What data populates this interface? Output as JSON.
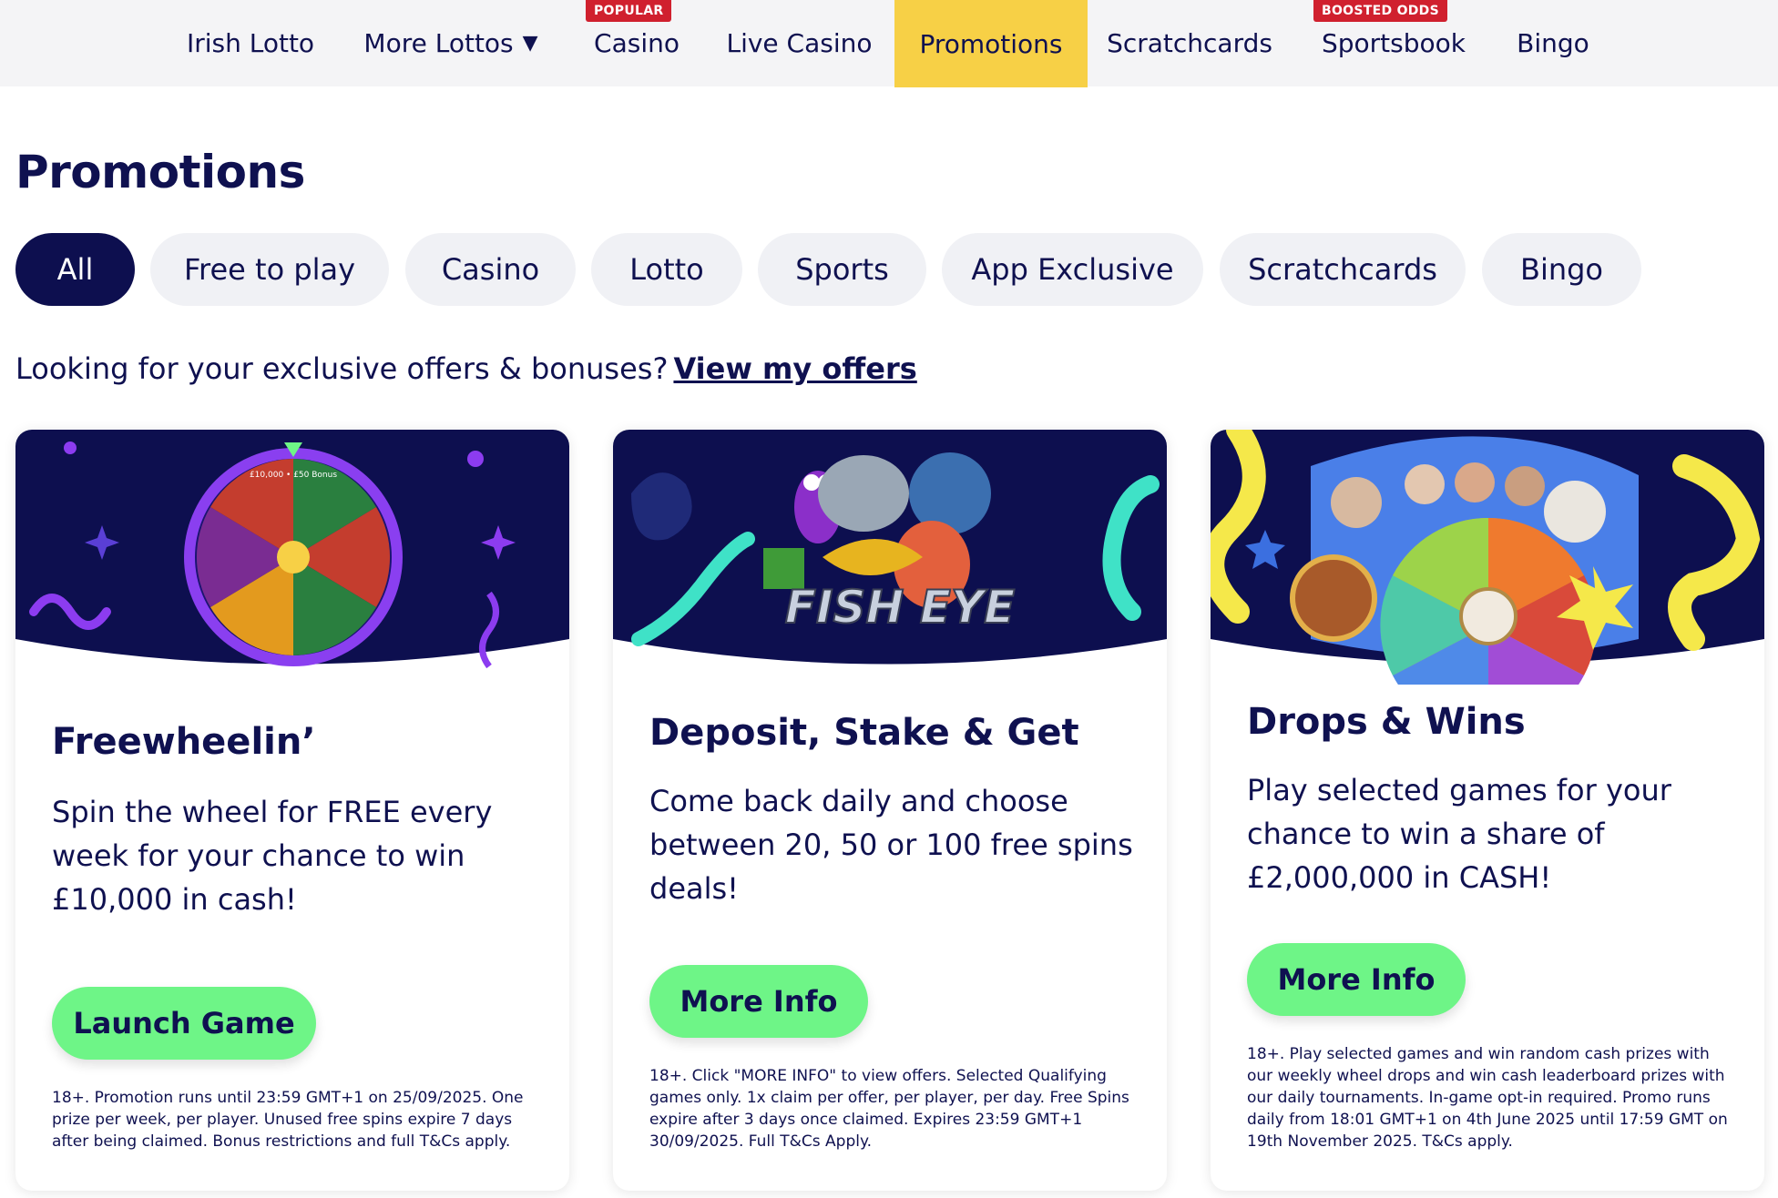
{
  "nav": {
    "items": [
      {
        "label": "Irish Lotto",
        "badge": ""
      },
      {
        "label": "More Lottos",
        "badge": ""
      },
      {
        "label": "Casino",
        "badge": "POPULAR"
      },
      {
        "label": "Live Casino",
        "badge": ""
      },
      {
        "label": "Promotions",
        "badge": "",
        "active": true
      },
      {
        "label": "Scratchcards",
        "badge": ""
      },
      {
        "label": "Sportsbook",
        "badge": "BOOSTED ODDS"
      },
      {
        "label": "Bingo",
        "badge": ""
      }
    ]
  },
  "page": {
    "title": "Promotions",
    "offers_prompt": "Looking for your exclusive offers & bonuses?",
    "offers_link": "View my offers"
  },
  "filters": [
    {
      "label": "All",
      "active": true
    },
    {
      "label": "Free to play"
    },
    {
      "label": "Casino"
    },
    {
      "label": "Lotto"
    },
    {
      "label": "Sports"
    },
    {
      "label": "App Exclusive"
    },
    {
      "label": "Scratchcards"
    },
    {
      "label": "Bingo"
    }
  ],
  "cards": [
    {
      "title": "Freewheelin’",
      "description": "Spin the wheel for FREE every week for your chance to win £10,000 in cash!",
      "cta": "Launch Game",
      "terms": "18+. Promotion runs until 23:59 GMT+1 on 25/09/2025. One prize per week, per player. Unused free spins expire 7 days after being claimed. Bonus restrictions and full T&Cs apply.",
      "banner_text": "FISH EYE",
      "wheel_text": "£10,000 • £50 Bonus"
    },
    {
      "title": "Deposit, Stake & Get",
      "description": "Come back daily and choose between 20, 50 or 100 free spins deals!",
      "cta": "More Info",
      "terms": "18+. Click \"MORE INFO\" to view offers. Selected Qualifying games only. 1x claim per offer, per player, per day. Free Spins expire after 3 days once claimed. Expires 23:59 GMT+1 30/09/2025. Full T&Cs Apply."
    },
    {
      "title": "Drops & Wins",
      "description": "Play selected games for your chance to win a share of £2,000,000 in CASH!",
      "cta": "More Info",
      "terms": "18+. Play selected games and win random cash prizes with our weekly wheel drops and win cash leaderboard prizes with our daily tournaments. In-game opt-in required. Promo runs daily from 18:01 GMT+1 on 4th June 2025 until 17:59 GMT on 19th November 2025. T&Cs apply."
    }
  ],
  "colors": {
    "navy": "#0d0f4f",
    "accent_yellow": "#f7d046",
    "cta_green": "#6ef587",
    "badge_red": "#d0202e"
  }
}
